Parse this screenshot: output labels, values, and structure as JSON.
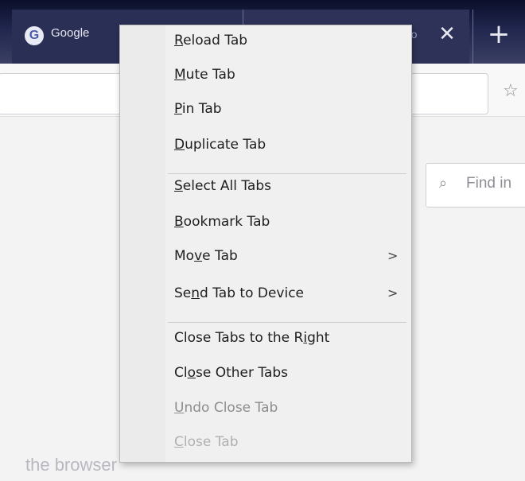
{
  "browser": {
    "tabs": [
      {
        "title": "Google",
        "icon": "google-icon"
      },
      {
        "title": "-o",
        "icon": ""
      }
    ],
    "find_placeholder": "Find in",
    "page_text": "the browser"
  },
  "context_menu": {
    "items": [
      {
        "label": "Reload Tab",
        "underline": 0
      },
      {
        "label": "Mute Tab",
        "underline": 0
      },
      {
        "label": "Pin Tab",
        "underline": 0
      },
      {
        "label": "Duplicate Tab",
        "underline": 0
      },
      {
        "label": "Select All Tabs",
        "underline": 0
      },
      {
        "label": "Bookmark Tab",
        "underline": 0
      },
      {
        "label": "Move Tab",
        "underline": 2
      },
      {
        "label": "Send Tab to Device",
        "underline": 2
      },
      {
        "label": "Close Tabs to the Right",
        "underline": 19
      },
      {
        "label": "Close Other Tabs",
        "underline": 2
      },
      {
        "label": "Undo Close Tab",
        "underline": 0
      },
      {
        "label": "Close Tab",
        "underline": 0
      }
    ]
  },
  "colors": {
    "tabstrip": "#20264d",
    "menu_bg": "#f0f0f0",
    "menu_text": "#1e1e1e"
  }
}
